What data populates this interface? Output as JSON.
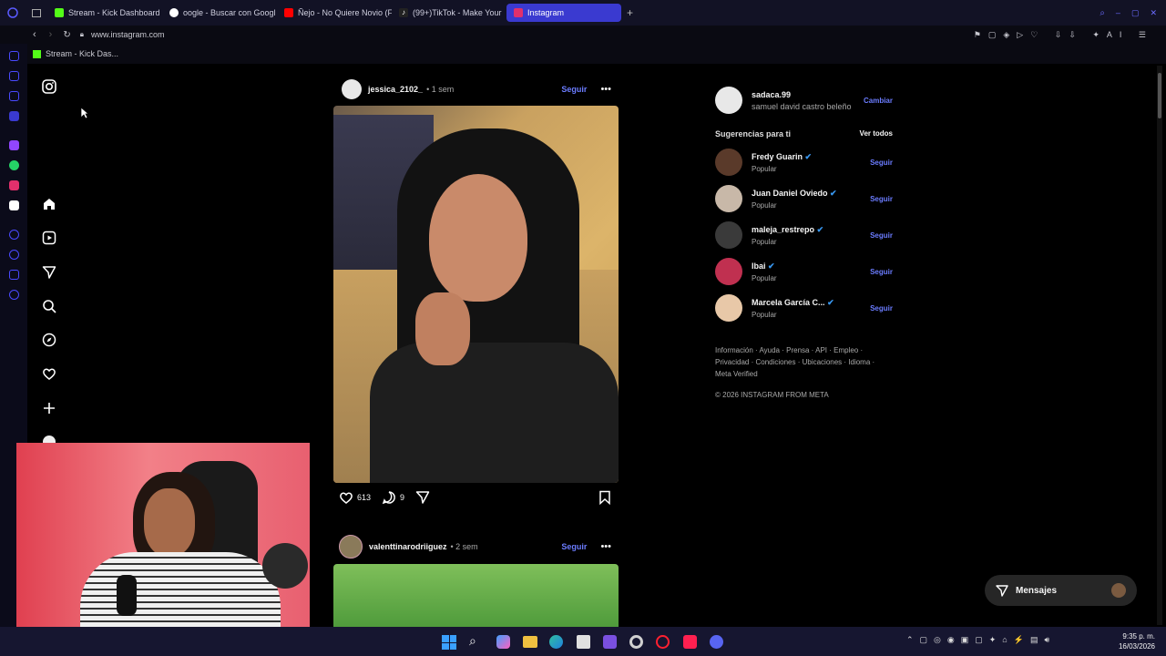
{
  "browser": {
    "tabs": [
      {
        "label": "Stream - Kick Dashboard",
        "icon": "kick-icon",
        "color": "#53fc18"
      },
      {
        "label": "oogle - Buscar con Googl",
        "icon": "google-icon",
        "color": "#ffffff"
      },
      {
        "label": "Ñejo - No Quiere Novio (F",
        "icon": "youtube-icon",
        "color": "#ff0000"
      },
      {
        "label": "(99+)TikTok - Make Your",
        "icon": "tiktok-icon",
        "color": "#ffffff"
      },
      {
        "label": "Instagram",
        "icon": "instagram-icon",
        "color": "#e1306c"
      }
    ],
    "url": "www.instagram.com",
    "bookmark": "Stream - Kick Das..."
  },
  "feed": {
    "posts": [
      {
        "username": "jessica_2102_",
        "time": "• 1 sem",
        "follow": "Seguir",
        "likes": "613",
        "comments": "9"
      },
      {
        "username": "valenttinarodriiguez",
        "time": "• 2 sem",
        "follow": "Seguir"
      }
    ]
  },
  "sidebar_right": {
    "user": {
      "username": "sadaca.99",
      "fullname": "samuel david castro beleño",
      "switch": "Cambiar"
    },
    "suggestions_title": "Sugerencias para ti",
    "see_all": "Ver todos",
    "suggestions": [
      {
        "name": "Fredy Guarin",
        "subtitle": "Popular",
        "action": "Seguir",
        "color": "#5a3a2a"
      },
      {
        "name": "Juan Daniel Oviedo",
        "subtitle": "Popular",
        "action": "Seguir",
        "color": "#c8b8a8"
      },
      {
        "name": "maleja_restrepo",
        "subtitle": "Popular",
        "action": "Seguir",
        "color": "#3a3a3a"
      },
      {
        "name": "Ibai",
        "subtitle": "Popular",
        "action": "Seguir",
        "color": "#c03050"
      },
      {
        "name": "Marcela García C...",
        "subtitle": "Popular",
        "action": "Seguir",
        "color": "#e8c8a8"
      }
    ],
    "footer_line1": "Información · Ayuda · Prensa · API · Empleo ·",
    "footer_line2": "Privacidad · Condiciones · Ubicaciones · Idioma ·",
    "footer_line3": "Meta Verified",
    "copyright": "© 2026 INSTAGRAM FROM META"
  },
  "messages_label": "Mensajes",
  "taskbar": {
    "time": "9:35 p. m.",
    "date": "16/03/2026"
  }
}
